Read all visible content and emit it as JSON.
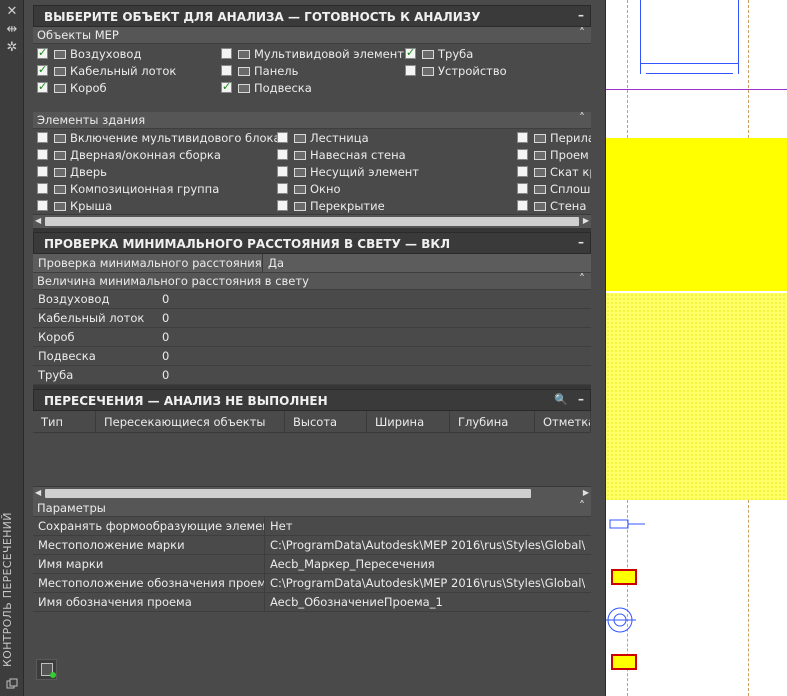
{
  "palette": {
    "vertical_title": "КОНТРОЛЬ ПЕРЕСЕЧЕНИЙ",
    "close_icon": "✕",
    "pin_icon": "⇹",
    "settings_icon": "✲"
  },
  "select_section": {
    "title": "ВЫБЕРИТЕ ОБЪЕКТ ДЛЯ АНАЛИЗА — ГОТОВНОСТЬ К АНАЛИЗУ",
    "collapse": "–",
    "mep_header": "Объекты МЕР",
    "mep_items": [
      {
        "label": "Воздуховод",
        "checked": true
      },
      {
        "label": "Кабельный лоток",
        "checked": true
      },
      {
        "label": "Короб",
        "checked": true
      },
      {
        "label": "Мультивидовой элемент",
        "checked": false
      },
      {
        "label": "Панель",
        "checked": false
      },
      {
        "label": "Подвеска",
        "checked": true
      },
      {
        "label": "Труба",
        "checked": true
      },
      {
        "label": "Устройство",
        "checked": false
      }
    ],
    "building_header": "Элементы здания",
    "building_items": [
      {
        "label": "Включение мультивидового блока",
        "checked": false
      },
      {
        "label": "Дверная/оконная сборка",
        "checked": false
      },
      {
        "label": "Дверь",
        "checked": false
      },
      {
        "label": "Композиционная группа",
        "checked": false
      },
      {
        "label": "Крыша",
        "checked": false
      },
      {
        "label": "Лестница",
        "checked": false
      },
      {
        "label": "Навесная стена",
        "checked": false
      },
      {
        "label": "Несущий элемент",
        "checked": false
      },
      {
        "label": "Окно",
        "checked": false
      },
      {
        "label": "Перекрытие",
        "checked": false
      },
      {
        "label": "Перила",
        "checked": false
      },
      {
        "label": "Проем",
        "checked": false
      },
      {
        "label": "Скат кр",
        "checked": false
      },
      {
        "label": "Сплош",
        "checked": false
      },
      {
        "label": "Стена",
        "checked": false
      }
    ],
    "chevron": "˄"
  },
  "clearance_section": {
    "title": "ПРОВЕРКА МИНИМАЛЬНОГО РАССТОЯНИЯ В СВЕТУ — ВКЛ",
    "collapse": "–",
    "check_row": {
      "key": "Проверка минимального расстояния в...",
      "value": "Да"
    },
    "values_header": "Величина минимального расстояния в свету",
    "rows": [
      {
        "key": "Воздуховод",
        "value": "0"
      },
      {
        "key": "Кабельный лоток",
        "value": "0"
      },
      {
        "key": "Короб",
        "value": "0"
      },
      {
        "key": "Подвеска",
        "value": "0"
      },
      {
        "key": "Труба",
        "value": "0"
      }
    ]
  },
  "intersections_section": {
    "title": "ПЕРЕСЕЧЕНИЯ — АНАЛИЗ НЕ ВЫПОЛНЕН",
    "collapse": "–",
    "zoom_icon": "🔍",
    "columns": [
      "Тип",
      "Пересекающиеся объекты",
      "Высота",
      "Ширина",
      "Глубина",
      "Отметка"
    ],
    "params_header": "Параметры",
    "params": [
      {
        "key": "Сохранять формообразующие элемен...",
        "value": "Нет"
      },
      {
        "key": "Местоположение марки",
        "value": "C:\\ProgramData\\Autodesk\\MEP 2016\\rus\\Styles\\Global\\I..."
      },
      {
        "key": "Имя марки",
        "value": "Aecb_Маркер_Пересечения"
      },
      {
        "key": "Местоположение обозначения проема",
        "value": "C:\\ProgramData\\Autodesk\\MEP 2016\\rus\\Styles\\Global\\I..."
      },
      {
        "key": "Имя обозначения проема",
        "value": "Aecb_ОбозначениеПроема_1"
      }
    ]
  },
  "colors": {
    "panel_bg": "#4a4a4a",
    "header_bg": "#3a3a3a",
    "cad_yellow": "#ffff00",
    "cad_blue": "#3355ff"
  }
}
